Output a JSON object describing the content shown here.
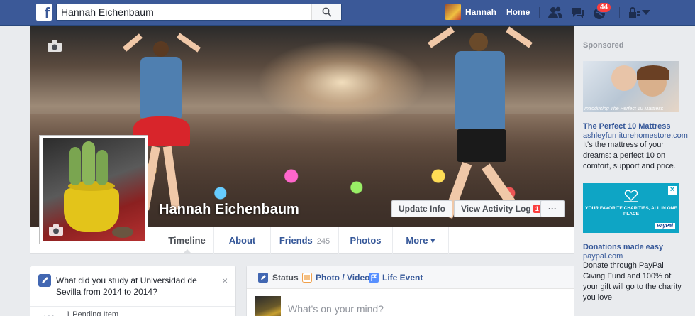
{
  "topbar": {
    "logo": "f",
    "search_value": "Hannah Eichenbaum",
    "user_name": "Hannah",
    "home_label": "Home",
    "notification_count": "44",
    "icons": [
      "friend-requests-icon",
      "messages-icon",
      "globe-notifications-icon",
      "privacy-lock-icon",
      "dropdown-caret-icon"
    ]
  },
  "cover": {
    "name": "Hannah Eichenbaum",
    "update_info_label": "Update Info",
    "activity_log_label": "View Activity Log",
    "activity_log_count": "1",
    "more_label": "···"
  },
  "nav": {
    "tabs": [
      {
        "label": "Timeline"
      },
      {
        "label": "About"
      },
      {
        "label": "Friends",
        "count": "245"
      },
      {
        "label": "Photos"
      },
      {
        "label": "More ▾"
      }
    ]
  },
  "sponsored": {
    "title": "Sponsored",
    "ads": [
      {
        "image_caption": "Introducing The Perfect 10 Mattress",
        "title": "The Perfect 10 Mattress",
        "domain": "ashleyfurniturehomestore.com",
        "text": "It's the mattress of your dreams: a perfect 10 on comfort, support and price."
      },
      {
        "image_text": "YOUR FAVORITE CHARITIES, ALL IN ONE PLACE",
        "image_brand": "PayPal",
        "title": "Donations made easy",
        "domain": "paypal.com",
        "text": "Donate through PayPal Giving Fund and 100% of your gift will go to the charity you love"
      }
    ]
  },
  "left_card": {
    "question": "What did you study at Universidad de Sevilla from 2014 to 2014?",
    "close": "×",
    "pending": "1 Pending Item"
  },
  "composer": {
    "status_label": "Status",
    "photo_label": "Photo / Video",
    "event_label": "Life Event",
    "placeholder": "What's on your mind?"
  },
  "colors": {
    "topbar": "#3b5998",
    "link": "#365899",
    "badge": "#fa3e3e"
  }
}
